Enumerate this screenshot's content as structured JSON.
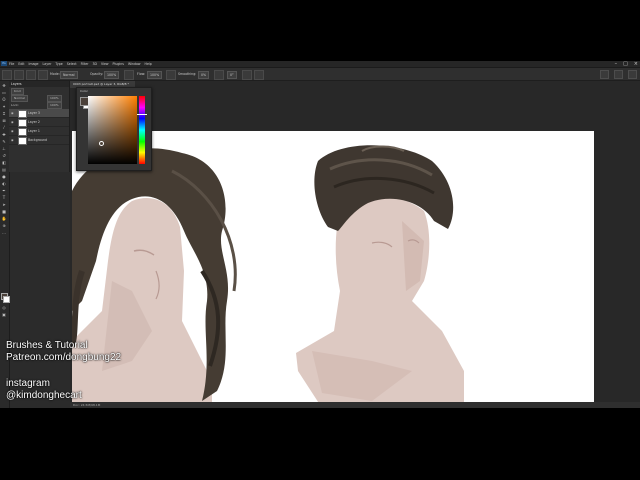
{
  "menubar": {
    "logo": "Ps",
    "items": [
      "File",
      "Edit",
      "Image",
      "Layer",
      "Type",
      "Select",
      "Filter",
      "3D",
      "View",
      "Plugins",
      "Window",
      "Help"
    ],
    "window_controls": [
      "–",
      "□",
      "×"
    ]
  },
  "options": {
    "mode_label": "Mode:",
    "mode_value": "Normal",
    "opacity_label": "Opacity:",
    "opacity_value": "100%",
    "flow_label": "Flow:",
    "flow_value": "100%",
    "smoothing_label": "Smoothing:",
    "smoothing_value": "0%",
    "angle_value": "0°"
  },
  "layers_panel": {
    "tab_label": "Layers",
    "kind_label": "Kind",
    "blend_value": "Normal",
    "opacity_value": "100%",
    "lock_label": "Lock:",
    "fill_value": "100%",
    "items": [
      {
        "name": "Layer 3",
        "selected": true
      },
      {
        "name": "Layer 2",
        "selected": false
      },
      {
        "name": "Layer 1",
        "selected": false
      },
      {
        "name": "Background",
        "selected": false
      }
    ]
  },
  "document": {
    "tab_title": "0003 portrait.psd @ Layer 3, RGB/8 *"
  },
  "color_picker": {
    "title": "Color",
    "foreground": "#4a4039",
    "background": "#ffffff",
    "hue_color": "#ff7f00"
  },
  "status": {
    "text": "Doc: 24.5M/98.1M"
  },
  "overlay": {
    "line1": "Brushes & Tutorial",
    "line2": "Patreon.com/dongbung22",
    "line3": "instagram",
    "line4": "@kimdonghecart"
  }
}
